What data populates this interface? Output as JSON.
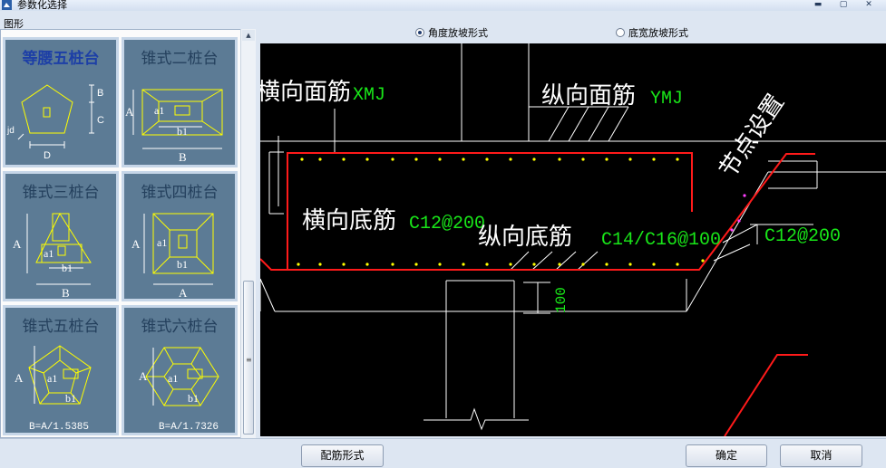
{
  "window": {
    "title": "参数化选择",
    "min": "▬",
    "max": "▢",
    "close": "✕"
  },
  "left": {
    "section_label": "图形",
    "cards": [
      {
        "title": "等腰五桩台",
        "labels": [
          "B",
          "C",
          "jd",
          "D"
        ]
      },
      {
        "title": "锥式二桩台",
        "labels": [
          "A",
          "a1",
          "b1",
          "B"
        ]
      },
      {
        "title": "锥式三桩台",
        "labels": [
          "A",
          "a1",
          "b1",
          "B"
        ]
      },
      {
        "title": "锥式四桩台",
        "labels": [
          "A",
          "a1",
          "b1",
          "A"
        ]
      },
      {
        "title": "锥式五桩台",
        "labels": [
          "A",
          "a1",
          "b1",
          "B=A/1.5385"
        ]
      },
      {
        "title": "锥式六桩台",
        "labels": [
          "A",
          "a1",
          "b1",
          "B=A/1.7326"
        ]
      }
    ]
  },
  "options": {
    "angle_label": "角度放坡形式",
    "width_label": "底宽放坡形式",
    "selected": "angle"
  },
  "drawing": {
    "heng_mian": "横向面筋",
    "heng_mian_code": "XMJ",
    "zong_mian": "纵向面筋",
    "zong_mian_code": "YMJ",
    "jiedian": "节点设置",
    "heng_di": "横向底筋",
    "heng_di_code": "C12@200",
    "zong_di": "纵向底筋",
    "zong_di_code": "C14/C16@100",
    "slope_code": "C12@200",
    "dim": "100"
  },
  "buttons": {
    "rebar_form": "配筋形式",
    "ok": "确定",
    "cancel": "取消"
  },
  "colors": {
    "rebar": "#ff1a1a",
    "dot": "#ffff00",
    "code": "#19e619",
    "line": "#ffffff"
  }
}
